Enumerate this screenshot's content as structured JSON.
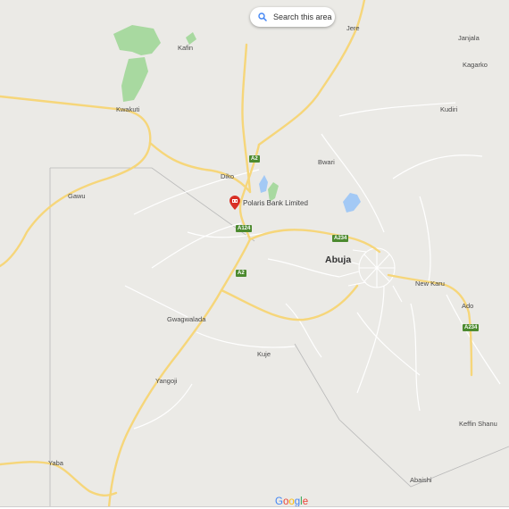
{
  "map": {
    "search_button": {
      "label": "Search this area",
      "icon": "search-icon"
    },
    "poi": {
      "label": "Polaris Bank Limited",
      "icon": "bank-pin-icon",
      "color": "#d93025"
    },
    "places": [
      {
        "id": "jere",
        "label": "Jere"
      },
      {
        "id": "janjala",
        "label": "Janjala"
      },
      {
        "id": "kafin",
        "label": "Kafin"
      },
      {
        "id": "kagarko",
        "label": "Kagarko"
      },
      {
        "id": "kwakuti",
        "label": "Kwakuti"
      },
      {
        "id": "kudiri",
        "label": "Kudiri"
      },
      {
        "id": "bwari",
        "label": "Bwari"
      },
      {
        "id": "diko",
        "label": "Diko"
      },
      {
        "id": "gawu",
        "label": "Gawu"
      },
      {
        "id": "abuja",
        "label": "Abuja"
      },
      {
        "id": "new_karu",
        "label": "New Karu"
      },
      {
        "id": "ado",
        "label": "Ado"
      },
      {
        "id": "gwagwalada",
        "label": "Gwagwalada"
      },
      {
        "id": "kuje",
        "label": "Kuje"
      },
      {
        "id": "yangoji",
        "label": "Yangoji"
      },
      {
        "id": "keffin_shanu",
        "label": "Keffin Shanu"
      },
      {
        "id": "yaba",
        "label": "Yaba"
      },
      {
        "id": "abaishi",
        "label": "Abaishi"
      }
    ],
    "road_shields": [
      "A2",
      "A124",
      "A2",
      "A234",
      "A234"
    ],
    "logo": {
      "letters": [
        "G",
        "o",
        "o",
        "g",
        "l",
        "e"
      ],
      "colors": [
        "#4285f4",
        "#ea4335",
        "#fbbc05",
        "#4285f4",
        "#34a853",
        "#ea4335"
      ]
    },
    "colors": {
      "background": "#ebeae6",
      "road": "#f6d67a",
      "minor_road": "#ffffff",
      "park": "#a8d9a0",
      "water": "#a3c9f5",
      "shield": "#4c8a2f"
    }
  }
}
